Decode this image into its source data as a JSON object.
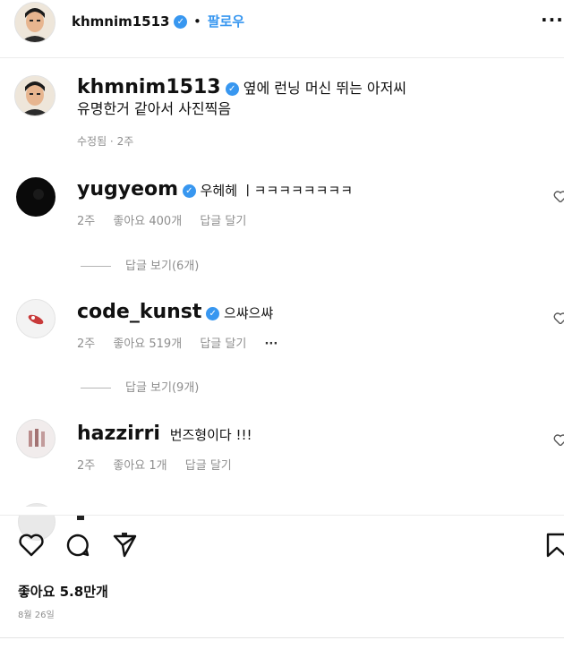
{
  "header": {
    "username": "khmnim1513",
    "separator": "•",
    "follow_label": "팔로우",
    "more_icon": "more-horizontal-icon"
  },
  "caption": {
    "username": "khmnim1513",
    "text_line1": "옆에 런닝 머신 뛰는 아저씨",
    "text_line2": "유명한거 같아서 사진찍음",
    "meta": "수정됨 · 2주"
  },
  "comments": [
    {
      "username": "yugyeom",
      "verified": true,
      "text": "우헤헤 ㅣㅋㅋㅋㅋㅋㅋㅋㅋ",
      "time": "2주",
      "likes": "좋아요 400개",
      "reply": "답글 달기",
      "view_replies": "답글 보기(6개)"
    },
    {
      "username": "code_kunst",
      "verified": true,
      "text": "으쌰으쌰",
      "time": "2주",
      "likes": "좋아요 519개",
      "reply": "답글 달기",
      "more": "···",
      "view_replies": "답글 보기(9개)"
    },
    {
      "username": "hazzirri",
      "verified": false,
      "text": "번즈형이다 !!!",
      "time": "2주",
      "likes": "좋아요 1개",
      "reply": "답글 달기"
    }
  ],
  "actions": {
    "like_icon": "heart-icon",
    "comment_icon": "comment-icon",
    "share_icon": "send-icon",
    "save_icon": "bookmark-icon"
  },
  "footer": {
    "likes": "좋아요 5.8만개",
    "date": "8월 26일"
  },
  "colors": {
    "follow": "#3897f0",
    "verified": "#3897f0",
    "muted": "#8e8e8e"
  }
}
